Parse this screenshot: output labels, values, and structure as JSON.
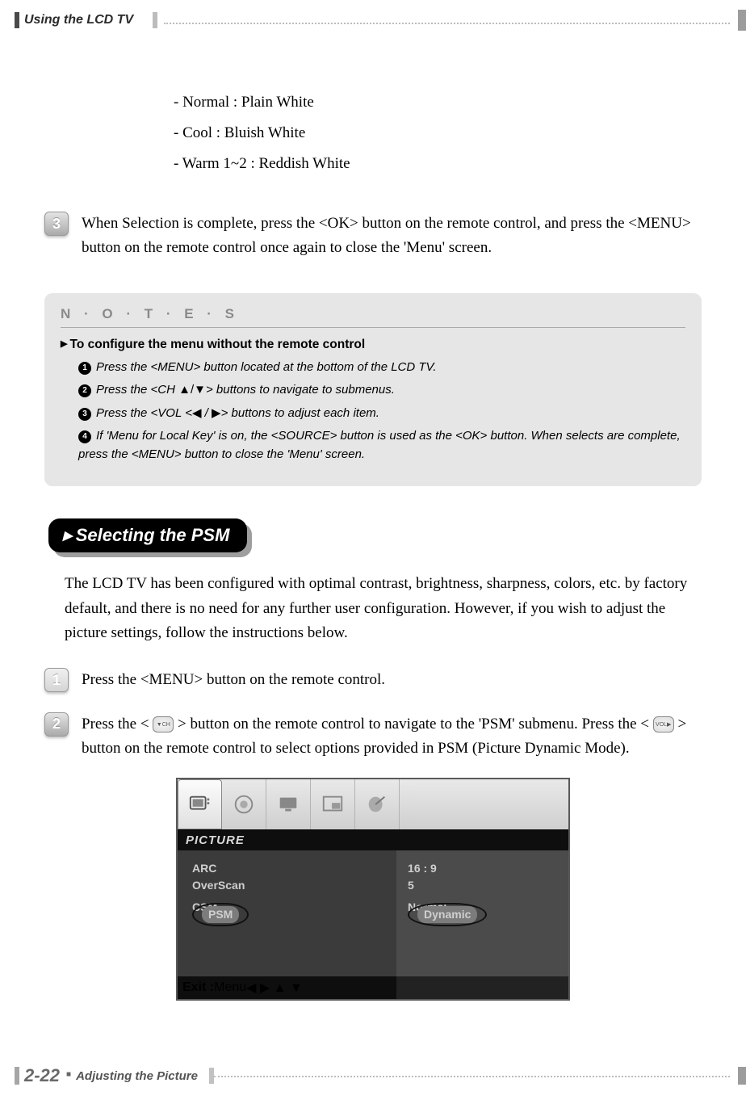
{
  "header": {
    "section": "Using the LCD TV"
  },
  "color_modes": [
    "- Normal : Plain White",
    "- Cool : Bluish White",
    "- Warm 1~2 : Reddish White"
  ],
  "step3": {
    "num": "3",
    "text": "When Selection is complete, press the <OK> button on the remote control, and press the <MENU> button on the remote control once again to close the 'Menu' screen."
  },
  "notes": {
    "heading": "N · O · T · E · S",
    "title": "To configure the menu without the remote control",
    "items": [
      "Press the <MENU> button located at the bottom of the LCD TV.",
      "Press the <CH ▲/▼> buttons to navigate to submenus.",
      "Press the <VOL <◀ / ▶> buttons to adjust each item.",
      "If 'Menu for Local Key' is on, the <SOURCE> button is used as the <OK> button. When selects are complete, press the <MENU> button to close the 'Menu' screen."
    ]
  },
  "psm": {
    "heading": "Selecting the PSM",
    "intro": "The LCD TV has been configured with optimal contrast, brightness, sharpness, colors, etc. by factory default, and there is no need for any further user configuration. However, if you wish to adjust the picture settings, follow the instructions below.",
    "step1": {
      "num": "1",
      "text": "Press the <MENU> button on the remote control."
    },
    "step2": {
      "num": "2",
      "part1": "Press the < ",
      "part2": " > button on the remote control to navigate to the 'PSM' submenu. Press the < ",
      "part3": " > button on the remote control to select options provided in PSM (Picture Dynamic Mode)."
    }
  },
  "osd": {
    "title": "PICTURE",
    "left": {
      "arc": "ARC",
      "overscan": "OverScan",
      "csm": "CSM",
      "psm": "PSM"
    },
    "right": {
      "arc": "16 : 9",
      "overscan": "5",
      "csm": "Normal",
      "psm": "Dynamic"
    },
    "footer": {
      "exit": "Exit :",
      "menu": "Menu",
      "arrows": "◀ ▶ ▲ ▼"
    }
  },
  "footer": {
    "page": "2-22",
    "section": "Adjusting the Picture"
  }
}
